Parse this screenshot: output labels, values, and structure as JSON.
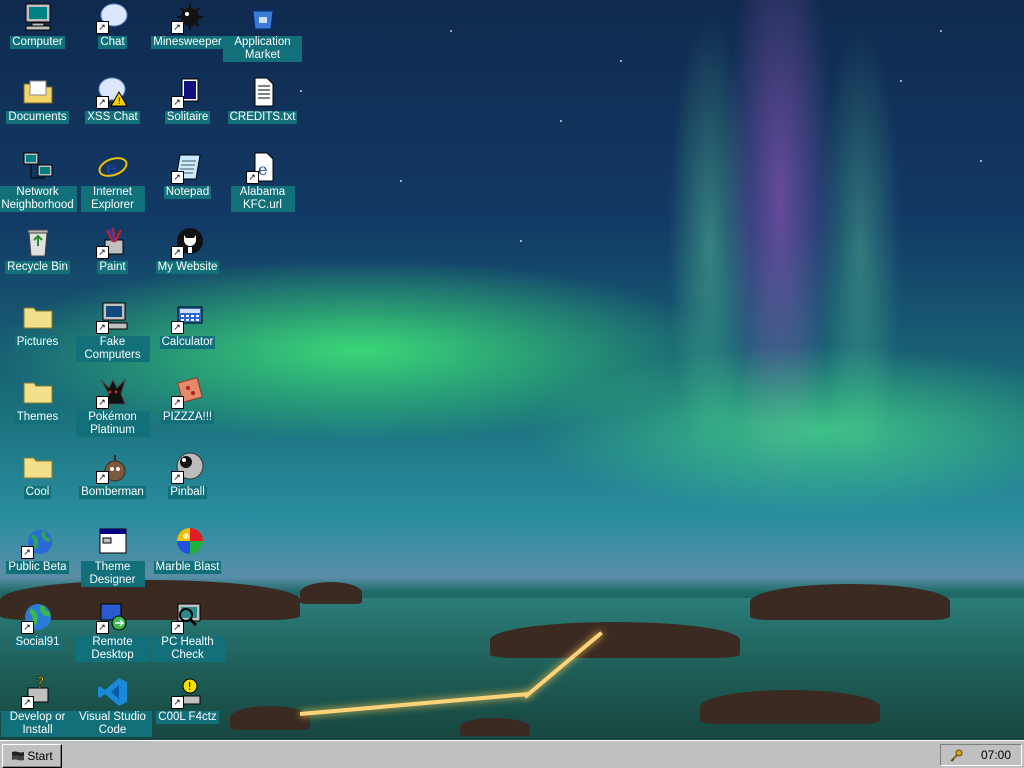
{
  "desktop": {
    "icons": [
      {
        "label": "Computer",
        "icon": "computer-icon"
      },
      {
        "label": "Chat",
        "icon": "chat-icon"
      },
      {
        "label": "Minesweeper",
        "icon": "minesweeper-icon"
      },
      {
        "label": "Application Market",
        "icon": "app-market-icon"
      },
      {
        "label": "Documents",
        "icon": "documents-folder-icon"
      },
      {
        "label": "XSS Chat",
        "icon": "xss-chat-icon"
      },
      {
        "label": "Solitaire",
        "icon": "solitaire-icon"
      },
      {
        "label": "CREDITS.txt",
        "icon": "text-file-icon"
      },
      {
        "label": "Network Neighborhood",
        "icon": "network-icon"
      },
      {
        "label": "Internet Explorer",
        "icon": "internet-explorer-icon"
      },
      {
        "label": "Notepad",
        "icon": "notepad-icon"
      },
      {
        "label": "Alabama KFC.url",
        "icon": "url-file-icon"
      },
      {
        "label": "Recycle Bin",
        "icon": "recycle-bin-icon"
      },
      {
        "label": "Paint",
        "icon": "paint-icon"
      },
      {
        "label": "My Website",
        "icon": "github-icon"
      },
      {
        "label": "Pictures",
        "icon": "folder-icon"
      },
      {
        "label": "Fake Computers",
        "icon": "fake-computers-icon"
      },
      {
        "label": "Calculator",
        "icon": "calculator-icon"
      },
      {
        "label": "Themes",
        "icon": "folder-icon"
      },
      {
        "label": "Pokémon Platinum",
        "icon": "pokemon-icon"
      },
      {
        "label": "PIZZZA!!!",
        "icon": "pizza-icon"
      },
      {
        "label": "Cool",
        "icon": "folder-icon"
      },
      {
        "label": "Bomberman",
        "icon": "bomberman-icon"
      },
      {
        "label": "Pinball",
        "icon": "pinball-icon"
      },
      {
        "label": "Public Beta",
        "icon": "globe-icon"
      },
      {
        "label": "Theme Designer",
        "icon": "theme-designer-icon"
      },
      {
        "label": "Marble Blast",
        "icon": "marble-icon"
      },
      {
        "label": "Social91",
        "icon": "social-globe-icon"
      },
      {
        "label": "Remote Desktop",
        "icon": "remote-desktop-icon"
      },
      {
        "label": "PC Health Check",
        "icon": "pc-health-icon"
      },
      {
        "label": "Develop or Install",
        "icon": "develop-install-icon"
      },
      {
        "label": "Visual Studio Code",
        "icon": "vscode-icon"
      },
      {
        "label": "C00L F4ctz",
        "icon": "cool-facts-icon"
      }
    ]
  },
  "taskbar": {
    "start_label": "Start",
    "clock": "07:00"
  },
  "colors": {
    "label_bg": "#11707a",
    "taskbar": "#c0c0c0"
  }
}
